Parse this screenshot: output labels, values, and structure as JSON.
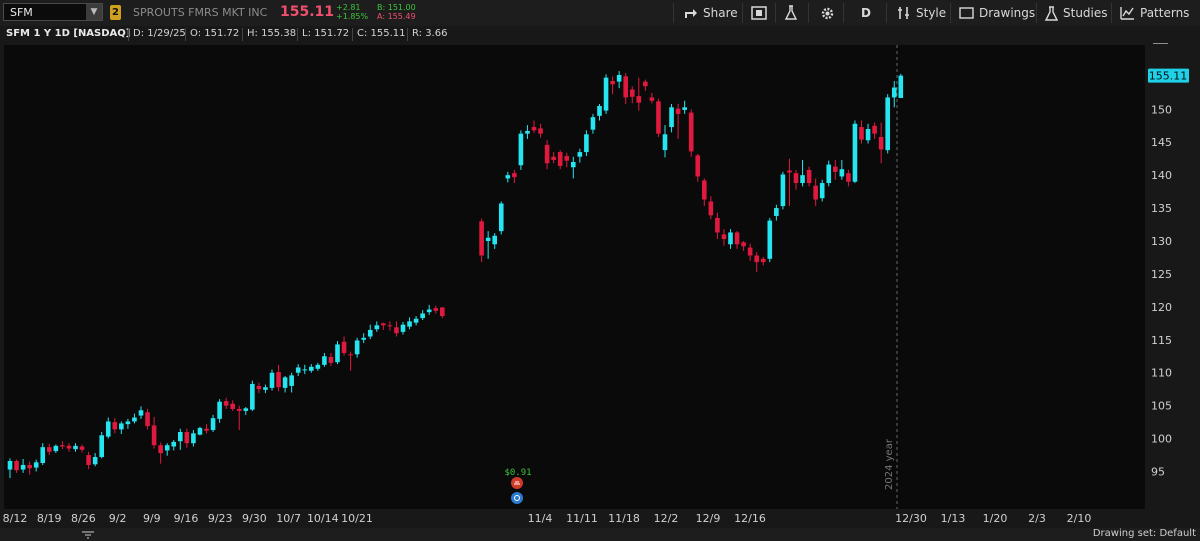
{
  "toolbar": {
    "symbol": "SFM",
    "link_badge": "2",
    "company_name": "SPROUTS FMRS MKT INC",
    "last_price": "155.11",
    "change": "+2.81",
    "change_pct": "+1.85%",
    "bid": "B: 151.00",
    "ask": "A: 155.49",
    "share_label": "Share",
    "period_label": "D",
    "style_label": "Style",
    "drawings_label": "Drawings",
    "studies_label": "Studies",
    "patterns_label": "Patterns"
  },
  "ohlc_bar": {
    "title": "SFM 1 Y 1D [NASDAQ]",
    "date": "D: 1/29/25",
    "open": "O: 151.72",
    "high": "H: 155.38",
    "low": "L: 151.72",
    "close": "C: 155.11",
    "range": "R: 3.66"
  },
  "status_bar": {
    "drawing_set": "Drawing set: Default"
  },
  "colors": {
    "up": "#25e6f0",
    "down": "#e0193f",
    "background": "#181818",
    "price_tag": "#1fd0e6"
  },
  "chart_data": {
    "type": "candlestick",
    "ylim": [
      92.5,
      159
    ],
    "y_ticks": [
      95,
      100,
      105,
      110,
      115,
      120,
      125,
      130,
      135,
      140,
      145,
      150
    ],
    "x_ticks": [
      "8/12",
      "8/19",
      "8/26",
      "9/2",
      "9/9",
      "9/16",
      "9/23",
      "9/30",
      "10/7",
      "10/14",
      "10/21",
      "11/4",
      "11/11",
      "11/18",
      "12/2",
      "12/9",
      "12/16",
      "12/30",
      "1/13",
      "1/20",
      "2/3",
      "2/10"
    ],
    "last_price_tag": "155.11",
    "year_marker_label": "2024 year",
    "dividend_label": "$0.91",
    "grid": false,
    "candles": [
      {
        "o": 95.3,
        "h": 97.0,
        "l": 94.0,
        "c": 96.6
      },
      {
        "o": 96.6,
        "h": 96.8,
        "l": 94.8,
        "c": 95.2
      },
      {
        "o": 95.3,
        "h": 96.9,
        "l": 94.8,
        "c": 96.0
      },
      {
        "o": 96.0,
        "h": 96.5,
        "l": 94.5,
        "c": 95.5
      },
      {
        "o": 95.6,
        "h": 96.8,
        "l": 95.0,
        "c": 96.4
      },
      {
        "o": 96.3,
        "h": 99.3,
        "l": 96.0,
        "c": 98.7
      },
      {
        "o": 98.7,
        "h": 99.2,
        "l": 97.5,
        "c": 98.0
      },
      {
        "o": 98.1,
        "h": 99.1,
        "l": 97.8,
        "c": 98.9
      },
      {
        "o": 99.0,
        "h": 99.6,
        "l": 98.4,
        "c": 98.8
      },
      {
        "o": 98.9,
        "h": 99.3,
        "l": 98.0,
        "c": 98.5
      },
      {
        "o": 98.4,
        "h": 99.3,
        "l": 98.0,
        "c": 98.9
      },
      {
        "o": 98.8,
        "h": 99.1,
        "l": 97.9,
        "c": 98.3
      },
      {
        "o": 97.5,
        "h": 98.0,
        "l": 95.4,
        "c": 96.0
      },
      {
        "o": 96.1,
        "h": 97.8,
        "l": 95.8,
        "c": 97.2
      },
      {
        "o": 97.2,
        "h": 101.0,
        "l": 97.0,
        "c": 100.5
      },
      {
        "o": 100.3,
        "h": 103.2,
        "l": 100.0,
        "c": 102.6
      },
      {
        "o": 102.5,
        "h": 103.1,
        "l": 100.8,
        "c": 101.4
      },
      {
        "o": 101.4,
        "h": 102.6,
        "l": 100.7,
        "c": 102.3
      },
      {
        "o": 102.2,
        "h": 103.0,
        "l": 101.5,
        "c": 102.6
      },
      {
        "o": 102.6,
        "h": 103.8,
        "l": 102.3,
        "c": 103.2
      },
      {
        "o": 103.5,
        "h": 104.9,
        "l": 103.0,
        "c": 104.3
      },
      {
        "o": 104.0,
        "h": 104.5,
        "l": 101.4,
        "c": 101.9
      },
      {
        "o": 102.0,
        "h": 103.3,
        "l": 98.5,
        "c": 99.0
      },
      {
        "o": 99.0,
        "h": 99.4,
        "l": 96.2,
        "c": 97.8
      },
      {
        "o": 98.2,
        "h": 99.3,
        "l": 97.4,
        "c": 99.0
      },
      {
        "o": 98.8,
        "h": 99.8,
        "l": 98.2,
        "c": 99.5
      },
      {
        "o": 99.6,
        "h": 101.5,
        "l": 98.3,
        "c": 101.0
      },
      {
        "o": 101.0,
        "h": 101.5,
        "l": 98.6,
        "c": 99.3
      },
      {
        "o": 99.3,
        "h": 101.3,
        "l": 98.8,
        "c": 100.8
      },
      {
        "o": 100.6,
        "h": 101.8,
        "l": 100.5,
        "c": 101.6
      },
      {
        "o": 101.5,
        "h": 102.2,
        "l": 100.8,
        "c": 101.2
      },
      {
        "o": 101.3,
        "h": 103.6,
        "l": 101.0,
        "c": 103.1
      },
      {
        "o": 103.0,
        "h": 106.0,
        "l": 102.4,
        "c": 105.6
      },
      {
        "o": 105.7,
        "h": 106.2,
        "l": 104.5,
        "c": 105.0
      },
      {
        "o": 105.3,
        "h": 105.8,
        "l": 104.2,
        "c": 104.5
      },
      {
        "o": 104.5,
        "h": 105.0,
        "l": 101.3,
        "c": 104.2
      },
      {
        "o": 104.2,
        "h": 104.8,
        "l": 103.6,
        "c": 104.6
      },
      {
        "o": 104.4,
        "h": 108.8,
        "l": 104.2,
        "c": 108.3
      },
      {
        "o": 108.0,
        "h": 108.5,
        "l": 106.9,
        "c": 107.5
      },
      {
        "o": 107.4,
        "h": 108.2,
        "l": 106.9,
        "c": 107.8
      },
      {
        "o": 107.7,
        "h": 110.5,
        "l": 107.3,
        "c": 110.0
      },
      {
        "o": 110.1,
        "h": 111.2,
        "l": 107.2,
        "c": 107.8
      },
      {
        "o": 107.7,
        "h": 109.5,
        "l": 107.0,
        "c": 109.3
      },
      {
        "o": 108.0,
        "h": 110.0,
        "l": 107.0,
        "c": 109.6
      },
      {
        "o": 110.0,
        "h": 111.3,
        "l": 109.5,
        "c": 110.8
      },
      {
        "o": 110.5,
        "h": 111.2,
        "l": 109.8,
        "c": 110.5
      },
      {
        "o": 110.3,
        "h": 111.3,
        "l": 110.0,
        "c": 110.9
      },
      {
        "o": 110.6,
        "h": 111.5,
        "l": 110.3,
        "c": 111.2
      },
      {
        "o": 111.2,
        "h": 113.0,
        "l": 110.9,
        "c": 112.5
      },
      {
        "o": 112.4,
        "h": 113.0,
        "l": 111.0,
        "c": 111.5
      },
      {
        "o": 111.6,
        "h": 114.8,
        "l": 111.3,
        "c": 114.3
      },
      {
        "o": 114.7,
        "h": 115.5,
        "l": 112.6,
        "c": 113.0
      },
      {
        "o": 112.8,
        "h": 113.2,
        "l": 110.3,
        "c": 112.7
      },
      {
        "o": 112.8,
        "h": 115.3,
        "l": 112.3,
        "c": 114.9
      },
      {
        "o": 115.0,
        "h": 116.0,
        "l": 114.5,
        "c": 115.3
      },
      {
        "o": 115.5,
        "h": 117.3,
        "l": 115.1,
        "c": 116.5
      },
      {
        "o": 116.6,
        "h": 117.8,
        "l": 116.2,
        "c": 117.2
      },
      {
        "o": 117.5,
        "h": 117.6,
        "l": 116.5,
        "c": 117.2
      },
      {
        "o": 117.2,
        "h": 117.8,
        "l": 116.4,
        "c": 117.1
      },
      {
        "o": 116.9,
        "h": 117.8,
        "l": 115.5,
        "c": 116.0
      },
      {
        "o": 116.2,
        "h": 117.7,
        "l": 115.8,
        "c": 117.3
      },
      {
        "o": 117.0,
        "h": 118.4,
        "l": 116.6,
        "c": 117.8
      },
      {
        "o": 117.6,
        "h": 118.6,
        "l": 117.2,
        "c": 118.2
      },
      {
        "o": 118.3,
        "h": 119.5,
        "l": 118.0,
        "c": 119.0
      },
      {
        "o": 119.2,
        "h": 120.3,
        "l": 118.8,
        "c": 119.6
      },
      {
        "o": 119.8,
        "h": 120.2,
        "l": 119.0,
        "c": 119.4
      },
      {
        "o": 119.9,
        "h": 120.0,
        "l": 118.3,
        "c": 118.6
      },
      {
        "o": 133.0,
        "h": 133.4,
        "l": 126.8,
        "c": 127.8
      },
      {
        "o": 130.0,
        "h": 131.5,
        "l": 127.3,
        "c": 130.5
      },
      {
        "o": 129.5,
        "h": 131.2,
        "l": 128.8,
        "c": 130.8
      },
      {
        "o": 131.5,
        "h": 136.0,
        "l": 131.0,
        "c": 135.7
      },
      {
        "o": 139.5,
        "h": 140.5,
        "l": 138.9,
        "c": 140.0
      },
      {
        "o": 140.3,
        "h": 140.8,
        "l": 138.8,
        "c": 139.7
      },
      {
        "o": 141.5,
        "h": 146.8,
        "l": 140.8,
        "c": 146.3
      },
      {
        "o": 146.3,
        "h": 147.6,
        "l": 145.5,
        "c": 146.7
      },
      {
        "o": 147.3,
        "h": 148.3,
        "l": 146.4,
        "c": 146.8
      },
      {
        "o": 147.1,
        "h": 147.8,
        "l": 145.7,
        "c": 146.3
      },
      {
        "o": 144.6,
        "h": 145.3,
        "l": 140.9,
        "c": 141.8
      },
      {
        "o": 142.8,
        "h": 143.5,
        "l": 141.8,
        "c": 142.3
      },
      {
        "o": 143.5,
        "h": 143.8,
        "l": 140.9,
        "c": 141.4
      },
      {
        "o": 142.9,
        "h": 143.4,
        "l": 141.2,
        "c": 142.2
      },
      {
        "o": 141.2,
        "h": 142.8,
        "l": 139.5,
        "c": 142.0
      },
      {
        "o": 142.8,
        "h": 144.0,
        "l": 141.9,
        "c": 143.5
      },
      {
        "o": 143.5,
        "h": 146.8,
        "l": 142.9,
        "c": 146.2
      },
      {
        "o": 146.9,
        "h": 149.3,
        "l": 146.3,
        "c": 148.8
      },
      {
        "o": 149.0,
        "h": 150.8,
        "l": 148.3,
        "c": 150.5
      },
      {
        "o": 149.8,
        "h": 155.3,
        "l": 149.3,
        "c": 154.8
      },
      {
        "o": 154.3,
        "h": 155.0,
        "l": 152.3,
        "c": 153.8
      },
      {
        "o": 154.2,
        "h": 155.8,
        "l": 153.2,
        "c": 155.2
      },
      {
        "o": 155.0,
        "h": 155.5,
        "l": 150.8,
        "c": 151.8
      },
      {
        "o": 153.0,
        "h": 153.5,
        "l": 150.9,
        "c": 151.9
      },
      {
        "o": 152.0,
        "h": 154.8,
        "l": 149.8,
        "c": 151.0
      },
      {
        "o": 154.2,
        "h": 154.5,
        "l": 152.8,
        "c": 153.5
      },
      {
        "o": 151.8,
        "h": 152.5,
        "l": 150.9,
        "c": 151.3
      },
      {
        "o": 151.2,
        "h": 151.6,
        "l": 145.8,
        "c": 146.3
      },
      {
        "o": 143.8,
        "h": 147.6,
        "l": 142.7,
        "c": 146.2
      },
      {
        "o": 147.3,
        "h": 150.8,
        "l": 146.5,
        "c": 150.3
      },
      {
        "o": 150.1,
        "h": 150.8,
        "l": 145.5,
        "c": 149.3
      },
      {
        "o": 149.9,
        "h": 151.3,
        "l": 149.3,
        "c": 150.3
      },
      {
        "o": 149.5,
        "h": 150.0,
        "l": 142.8,
        "c": 143.6
      },
      {
        "o": 143.0,
        "h": 143.2,
        "l": 139.0,
        "c": 139.8
      },
      {
        "o": 139.2,
        "h": 139.5,
        "l": 135.3,
        "c": 136.3
      },
      {
        "o": 136.0,
        "h": 136.8,
        "l": 133.3,
        "c": 133.9
      },
      {
        "o": 133.5,
        "h": 134.3,
        "l": 130.3,
        "c": 131.3
      },
      {
        "o": 131.0,
        "h": 131.8,
        "l": 129.3,
        "c": 130.3
      },
      {
        "o": 129.5,
        "h": 131.8,
        "l": 128.8,
        "c": 131.3
      },
      {
        "o": 131.3,
        "h": 131.5,
        "l": 128.8,
        "c": 129.5
      },
      {
        "o": 129.8,
        "h": 130.0,
        "l": 128.5,
        "c": 129.2
      },
      {
        "o": 129.0,
        "h": 129.6,
        "l": 127.0,
        "c": 127.8
      },
      {
        "o": 127.8,
        "h": 128.3,
        "l": 125.3,
        "c": 126.8
      },
      {
        "o": 127.3,
        "h": 127.6,
        "l": 126.3,
        "c": 126.8
      },
      {
        "o": 127.3,
        "h": 133.5,
        "l": 126.8,
        "c": 133.1
      },
      {
        "o": 133.8,
        "h": 135.5,
        "l": 133.1,
        "c": 135.0
      },
      {
        "o": 135.3,
        "h": 140.5,
        "l": 134.8,
        "c": 140.1
      },
      {
        "o": 140.7,
        "h": 142.5,
        "l": 135.3,
        "c": 140.4
      },
      {
        "o": 140.3,
        "h": 140.8,
        "l": 137.8,
        "c": 138.8
      },
      {
        "o": 138.8,
        "h": 142.3,
        "l": 138.3,
        "c": 140.0
      },
      {
        "o": 140.8,
        "h": 141.3,
        "l": 138.3,
        "c": 138.8
      },
      {
        "o": 138.4,
        "h": 139.5,
        "l": 135.3,
        "c": 136.3
      },
      {
        "o": 136.5,
        "h": 139.3,
        "l": 136.0,
        "c": 138.8
      },
      {
        "o": 138.8,
        "h": 142.2,
        "l": 138.3,
        "c": 141.6
      },
      {
        "o": 141.3,
        "h": 142.3,
        "l": 139.3,
        "c": 140.5
      },
      {
        "o": 139.8,
        "h": 142.3,
        "l": 139.3,
        "c": 140.9
      },
      {
        "o": 140.3,
        "h": 140.8,
        "l": 138.3,
        "c": 139.0
      },
      {
        "o": 139.0,
        "h": 148.3,
        "l": 138.8,
        "c": 147.8
      },
      {
        "o": 147.3,
        "h": 148.3,
        "l": 144.8,
        "c": 145.4
      },
      {
        "o": 145.3,
        "h": 147.8,
        "l": 144.8,
        "c": 147.0
      },
      {
        "o": 147.5,
        "h": 148.0,
        "l": 145.5,
        "c": 146.3
      },
      {
        "o": 145.8,
        "h": 148.0,
        "l": 141.8,
        "c": 143.9
      },
      {
        "o": 143.8,
        "h": 152.3,
        "l": 143.3,
        "c": 151.8
      },
      {
        "o": 151.8,
        "h": 154.3,
        "l": 150.3,
        "c": 153.3
      },
      {
        "o": 151.72,
        "h": 155.38,
        "l": 151.72,
        "c": 155.11
      }
    ]
  }
}
